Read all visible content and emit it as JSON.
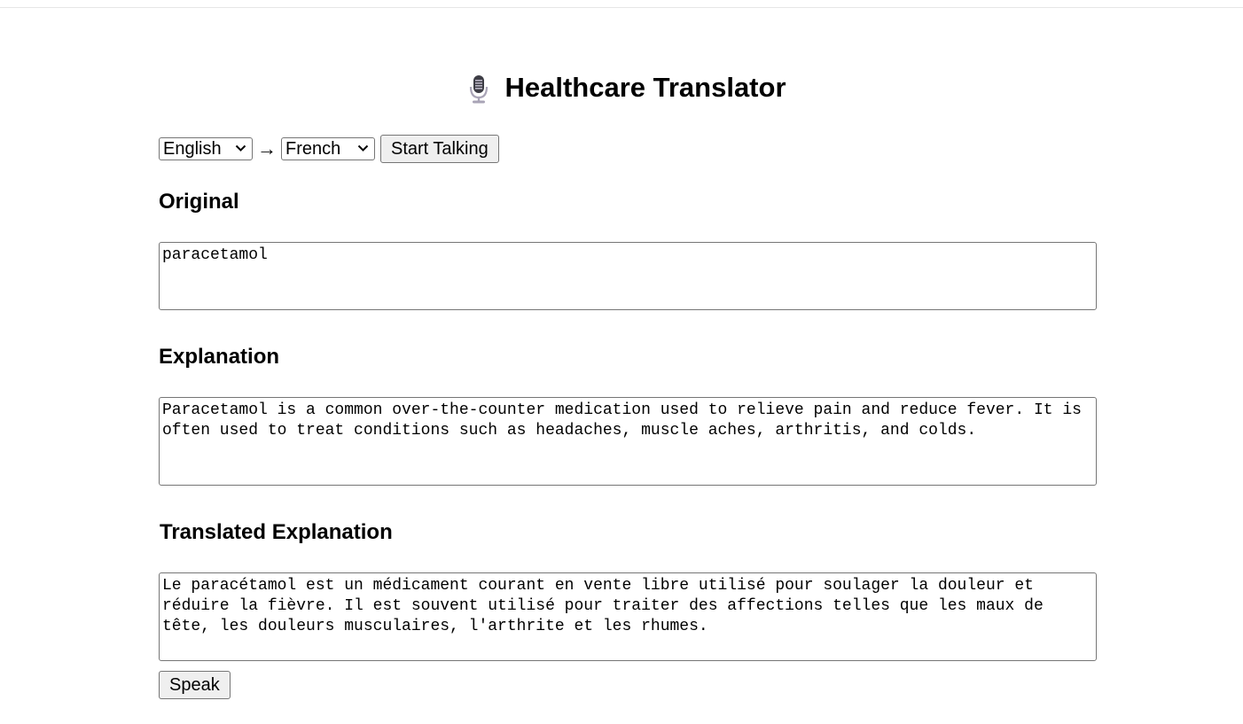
{
  "header": {
    "title": "Healthcare Translator",
    "icon": "microphone-icon"
  },
  "controls": {
    "source_language": "English",
    "arrow": "→",
    "target_language": "French",
    "start_label": "Start Talking"
  },
  "sections": {
    "original": {
      "heading": "Original",
      "value": "paracetamol"
    },
    "explanation": {
      "heading": "Explanation",
      "value": "Paracetamol is a common over-the-counter medication used to relieve pain and reduce fever. It is often used to treat conditions such as headaches, muscle aches, arthritis, and colds."
    },
    "translated": {
      "heading": "Translated Explanation",
      "value": "Le paracétamol est un médicament courant en vente libre utilisé pour soulager la douleur et réduire la fièvre. Il est souvent utilisé pour traiter des affections telles que les maux de tête, les douleurs musculaires, l'arthrite et les rhumes."
    }
  },
  "speak_label": "Speak",
  "colors": {
    "border": "#767676",
    "button_bg": "#efefef",
    "text": "#000000",
    "background": "#ffffff"
  }
}
